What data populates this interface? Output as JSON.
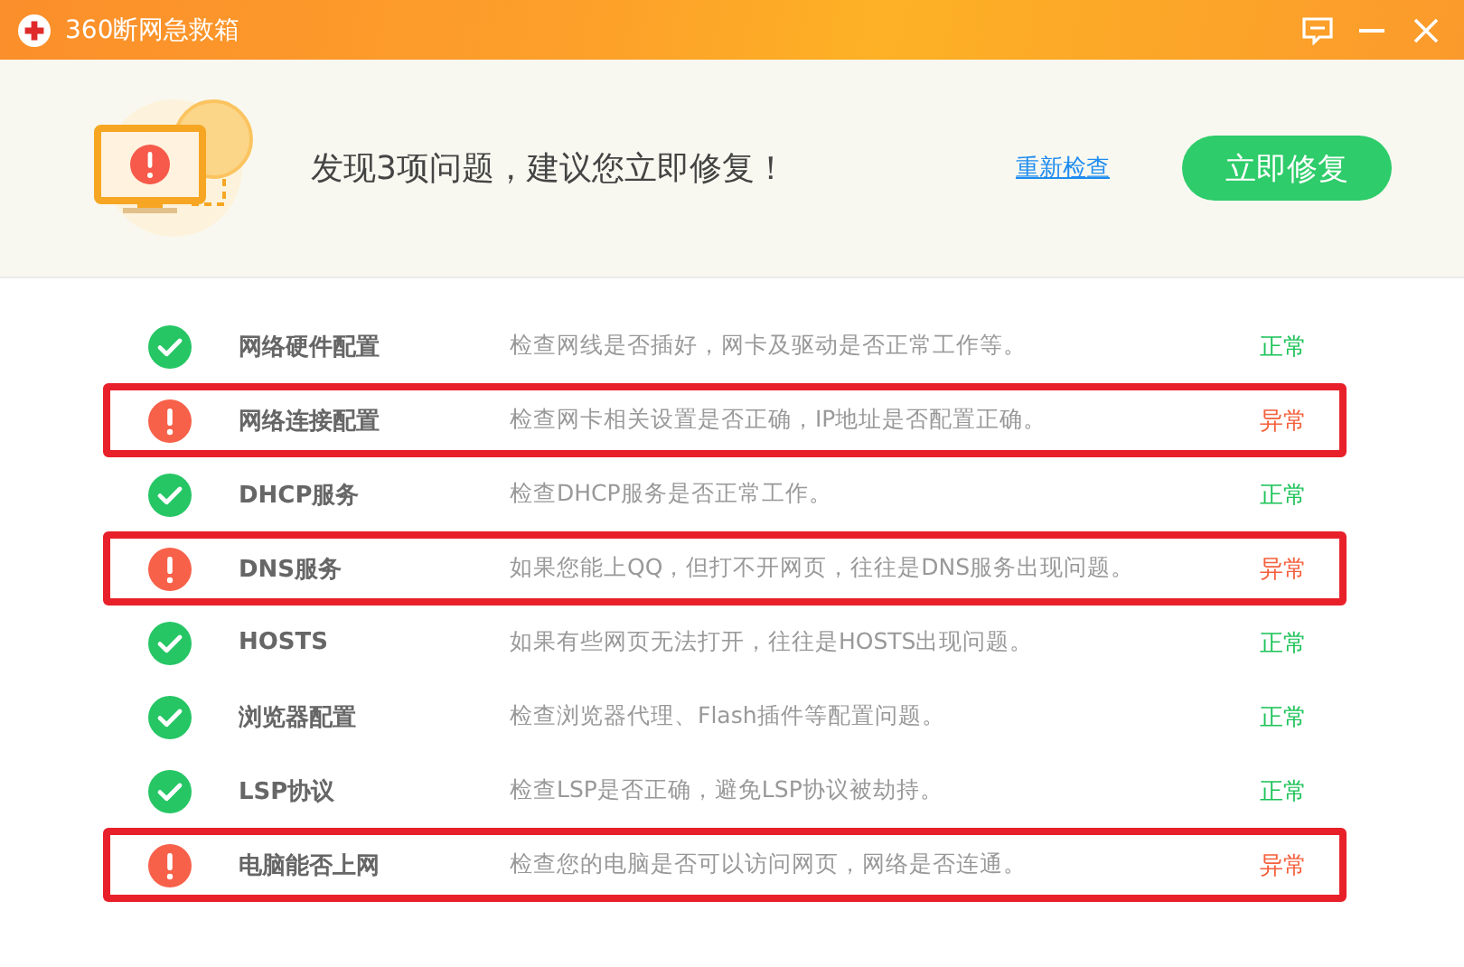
{
  "window": {
    "title": "360断网急救箱"
  },
  "summary": {
    "message": "发现3项问题，建议您立即修复！",
    "recheck_link": "重新检查",
    "fix_button": "立即修复"
  },
  "rows": [
    {
      "name": "网络硬件配置",
      "description": "检查网线是否插好，网卡及驱动是否正常工作等。",
      "kind": "ok",
      "status_text": "正常",
      "highlighted": false
    },
    {
      "name": "网络连接配置",
      "description": "检查网卡相关设置是否正确，IP地址是否配置正确。",
      "kind": "error",
      "status_text": "异常",
      "highlighted": true
    },
    {
      "name": "DHCP服务",
      "description": "检查DHCP服务是否正常工作。",
      "kind": "ok",
      "status_text": "正常",
      "highlighted": false
    },
    {
      "name": "DNS服务",
      "description": "如果您能上QQ，但打不开网页，往往是DNS服务出现问题。",
      "kind": "error",
      "status_text": "异常",
      "highlighted": true
    },
    {
      "name": "HOSTS",
      "description": "如果有些网页无法打开，往往是HOSTS出现问题。",
      "kind": "ok",
      "status_text": "正常",
      "highlighted": false
    },
    {
      "name": "浏览器配置",
      "description": "检查浏览器代理、Flash插件等配置问题。",
      "kind": "ok",
      "status_text": "正常",
      "highlighted": false
    },
    {
      "name": "LSP协议",
      "description": "检查LSP是否正确，避免LSP协议被劫持。",
      "kind": "ok",
      "status_text": "正常",
      "highlighted": false
    },
    {
      "name": "电脑能否上网",
      "description": "检查您的电脑是否可以访问网页，网络是否连通。",
      "kind": "error",
      "status_text": "异常",
      "highlighted": true
    }
  ]
}
